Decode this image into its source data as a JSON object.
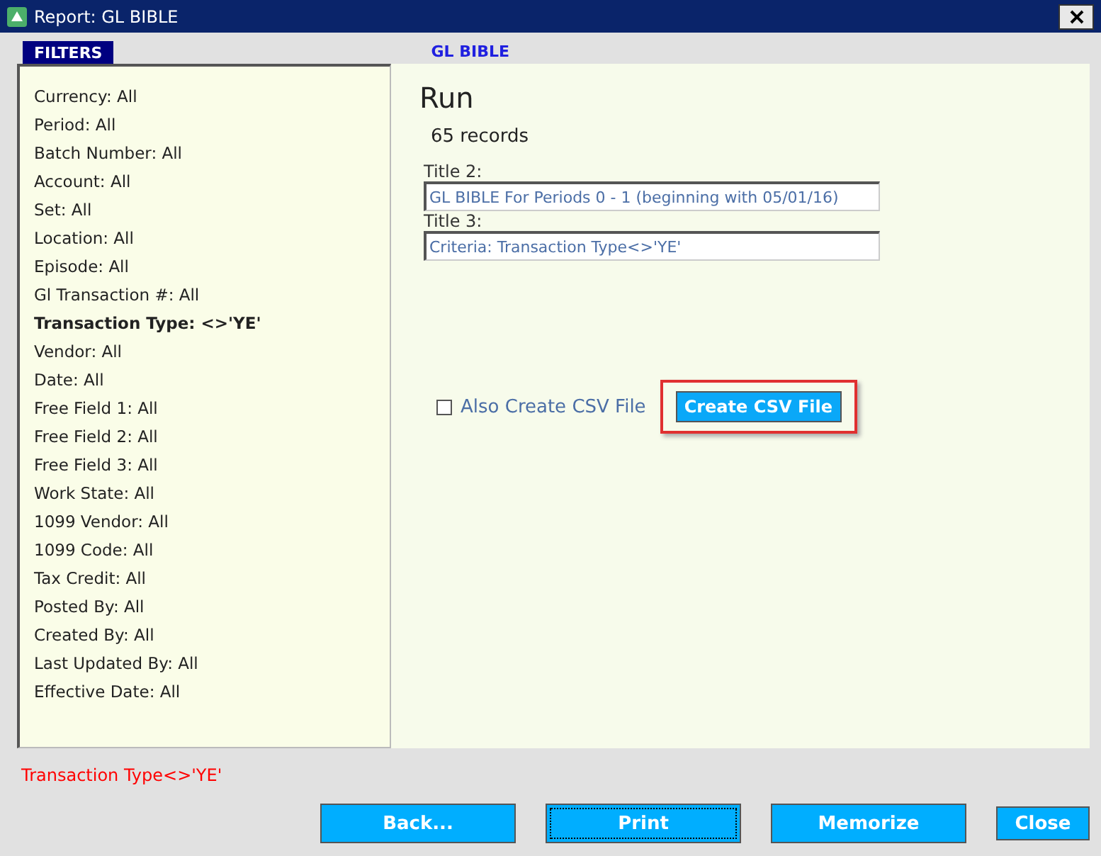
{
  "window": {
    "title": "Report: GL BIBLE"
  },
  "filters_tab": "FILTERS",
  "report_name": "GL BIBLE",
  "filters": [
    {
      "text": "Currency: All",
      "active": false
    },
    {
      "text": "Period: All",
      "active": false
    },
    {
      "text": "Batch Number: All",
      "active": false
    },
    {
      "text": "Account: All",
      "active": false
    },
    {
      "text": "Set: All",
      "active": false
    },
    {
      "text": "Location: All",
      "active": false
    },
    {
      "text": "Episode: All",
      "active": false
    },
    {
      "text": "Gl Transaction #: All",
      "active": false
    },
    {
      "text": "Transaction Type: <>'YE'",
      "active": true
    },
    {
      "text": "Vendor: All",
      "active": false
    },
    {
      "text": "Date: All",
      "active": false
    },
    {
      "text": "Free Field 1: All",
      "active": false
    },
    {
      "text": "Free Field 2: All",
      "active": false
    },
    {
      "text": "Free Field 3: All",
      "active": false
    },
    {
      "text": "Work State: All",
      "active": false
    },
    {
      "text": "1099 Vendor: All",
      "active": false
    },
    {
      "text": "1099 Code: All",
      "active": false
    },
    {
      "text": "Tax Credit: All",
      "active": false
    },
    {
      "text": "Posted By: All",
      "active": false
    },
    {
      "text": "Created By: All",
      "active": false
    },
    {
      "text": "Last Updated By: All",
      "active": false
    },
    {
      "text": "Effective Date: All",
      "active": false
    }
  ],
  "run": {
    "heading": "Run",
    "count": "65 records",
    "fields": [
      {
        "label": "Title 2:",
        "value": "GL BIBLE For Periods 0 - 1 (beginning with 05/01/16)"
      },
      {
        "label": "Title 3:",
        "value": "Criteria: Transaction Type<>'YE'"
      }
    ],
    "csv_checkbox": {
      "label": "Also Create CSV File",
      "checked": false
    },
    "csv_button": {
      "label": "Create CSV File",
      "highlighted": true
    }
  },
  "criteria_summary": "Transaction Type<>'YE'",
  "buttons": [
    {
      "label": "Back...",
      "focused": false,
      "kind": "wide"
    },
    {
      "label": "Print",
      "focused": true,
      "kind": "wide"
    },
    {
      "label": "Memorize",
      "focused": false,
      "kind": "wide"
    },
    {
      "label": "Close",
      "focused": false,
      "kind": "small"
    }
  ]
}
